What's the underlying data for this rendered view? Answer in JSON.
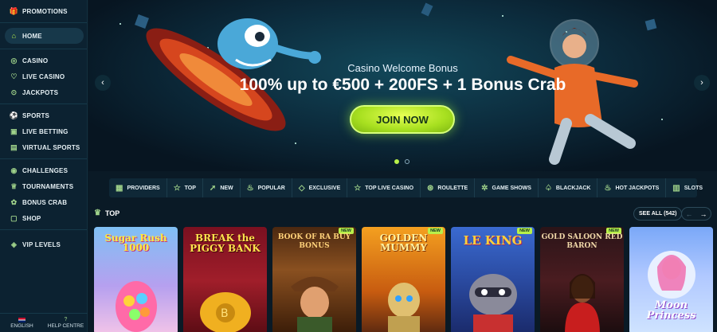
{
  "sidebar": {
    "group1": [
      {
        "label": "PROMOTIONS",
        "icon": "gift-icon"
      }
    ],
    "group2": [
      {
        "label": "HOME",
        "icon": "home-icon",
        "active": true
      }
    ],
    "group3": [
      {
        "label": "CASINO",
        "icon": "casino-chip-icon"
      },
      {
        "label": "LIVE CASINO",
        "icon": "live-icon"
      },
      {
        "label": "JACKPOTS",
        "icon": "jackpot-icon"
      }
    ],
    "group4": [
      {
        "label": "SPORTS",
        "icon": "ball-icon"
      },
      {
        "label": "LIVE BETTING",
        "icon": "live-betting-icon"
      },
      {
        "label": "VIRTUAL SPORTS",
        "icon": "virtual-sports-icon"
      }
    ],
    "group5": [
      {
        "label": "CHALLENGES",
        "icon": "target-icon"
      },
      {
        "label": "TOURNAMENTS",
        "icon": "trophy-icon"
      },
      {
        "label": "BONUS CRAB",
        "icon": "crab-icon"
      },
      {
        "label": "SHOP",
        "icon": "shop-icon"
      }
    ],
    "group6": [
      {
        "label": "VIP LEVELS",
        "icon": "vip-icon"
      }
    ],
    "bottom": {
      "language": "ENGLISH",
      "help": "HELP CENTRE"
    }
  },
  "hero": {
    "title": "Casino Welcome Bonus",
    "subtitle": "100% up to €500 + 200FS + 1 Bonus Crab",
    "cta": "JOIN NOW",
    "slides": 2,
    "active_slide": 1
  },
  "categories": [
    {
      "label": "PROVIDERS",
      "icon": "grid-icon"
    },
    {
      "label": "TOP",
      "icon": "star-icon"
    },
    {
      "label": "NEW",
      "icon": "rocket-icon"
    },
    {
      "label": "POPULAR",
      "icon": "flame-icon"
    },
    {
      "label": "EXCLUSIVE",
      "icon": "diamond-icon"
    },
    {
      "label": "TOP LIVE CASINO",
      "icon": "star-icon"
    },
    {
      "label": "ROULETTE",
      "icon": "roulette-icon"
    },
    {
      "label": "GAME SHOWS",
      "icon": "wheel-icon"
    },
    {
      "label": "BLACKJACK",
      "icon": "spade-icon"
    },
    {
      "label": "HOT JACKPOTS",
      "icon": "hot-icon"
    },
    {
      "label": "SLOTS",
      "icon": "slots-icon"
    }
  ],
  "top_section": {
    "title": "TOP",
    "see_all": "SEE ALL (542)",
    "games": [
      {
        "title": "Sugar Rush 1000",
        "new": false
      },
      {
        "title": "BREAK the PIGGY BANK",
        "new": false
      },
      {
        "title": "BOOK OF RA BUY BONUS",
        "new": true
      },
      {
        "title": "GOLDEN MUMMY",
        "new": true
      },
      {
        "title": "LE KING",
        "new": true
      },
      {
        "title": "GOLD SALOON RED BARON",
        "new": true
      },
      {
        "title": "Moon Princess",
        "new": false
      }
    ],
    "new_badge": "NEW"
  },
  "colors": {
    "accent": "#b8f04a",
    "background": "#0a1a26",
    "sidebar": "#0c2231"
  }
}
